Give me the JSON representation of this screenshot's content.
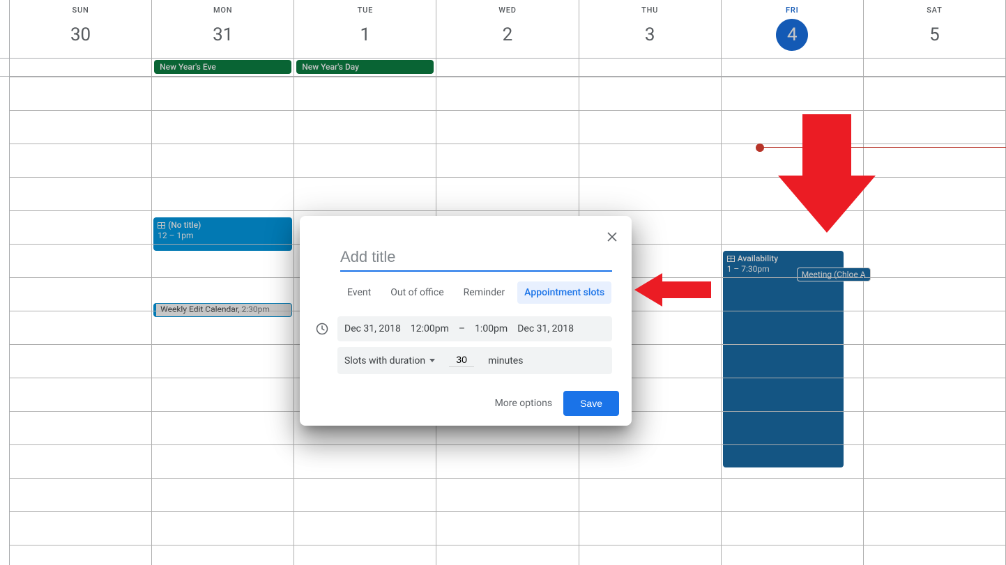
{
  "header": {
    "days": [
      {
        "label": "Sun",
        "num": "30",
        "today": false
      },
      {
        "label": "Mon",
        "num": "31",
        "today": false
      },
      {
        "label": "Tue",
        "num": "1",
        "today": false
      },
      {
        "label": "Wed",
        "num": "2",
        "today": false
      },
      {
        "label": "Thu",
        "num": "3",
        "today": false
      },
      {
        "label": "Fri",
        "num": "4",
        "today": true
      },
      {
        "label": "Sat",
        "num": "5",
        "today": false
      }
    ]
  },
  "holidays": {
    "mon": "New Year's Eve",
    "tue": "New Year's Day"
  },
  "events": {
    "mon_notitle": {
      "title": "(No title)",
      "time": "12 – 1pm"
    },
    "mon_weekly": {
      "title": "Weekly Edit Calendar,",
      "time": "2:30pm"
    },
    "fri_avail": {
      "title": "Availability",
      "time": "1 – 7:30pm"
    },
    "fri_meeting": "Meeting (Chloe A"
  },
  "dialog": {
    "title_placeholder": "Add title",
    "tabs": {
      "event": "Event",
      "ooo": "Out of office",
      "reminder": "Reminder",
      "appt": "Appointment slots"
    },
    "date_start": "Dec 31, 2018",
    "time_start": "12:00pm",
    "separator": "–",
    "time_end": "1:00pm",
    "date_end": "Dec 31, 2018",
    "slots_label": "Slots with duration",
    "slots_minutes": "30",
    "minutes_label": "minutes",
    "more_options": "More options",
    "save": "Save"
  },
  "colors": {
    "accent": "#1a73e8",
    "holiday": "#0b8043",
    "event_light": "#039be5",
    "event_dark": "#1a6da8",
    "arrow": "#eb1c24"
  }
}
